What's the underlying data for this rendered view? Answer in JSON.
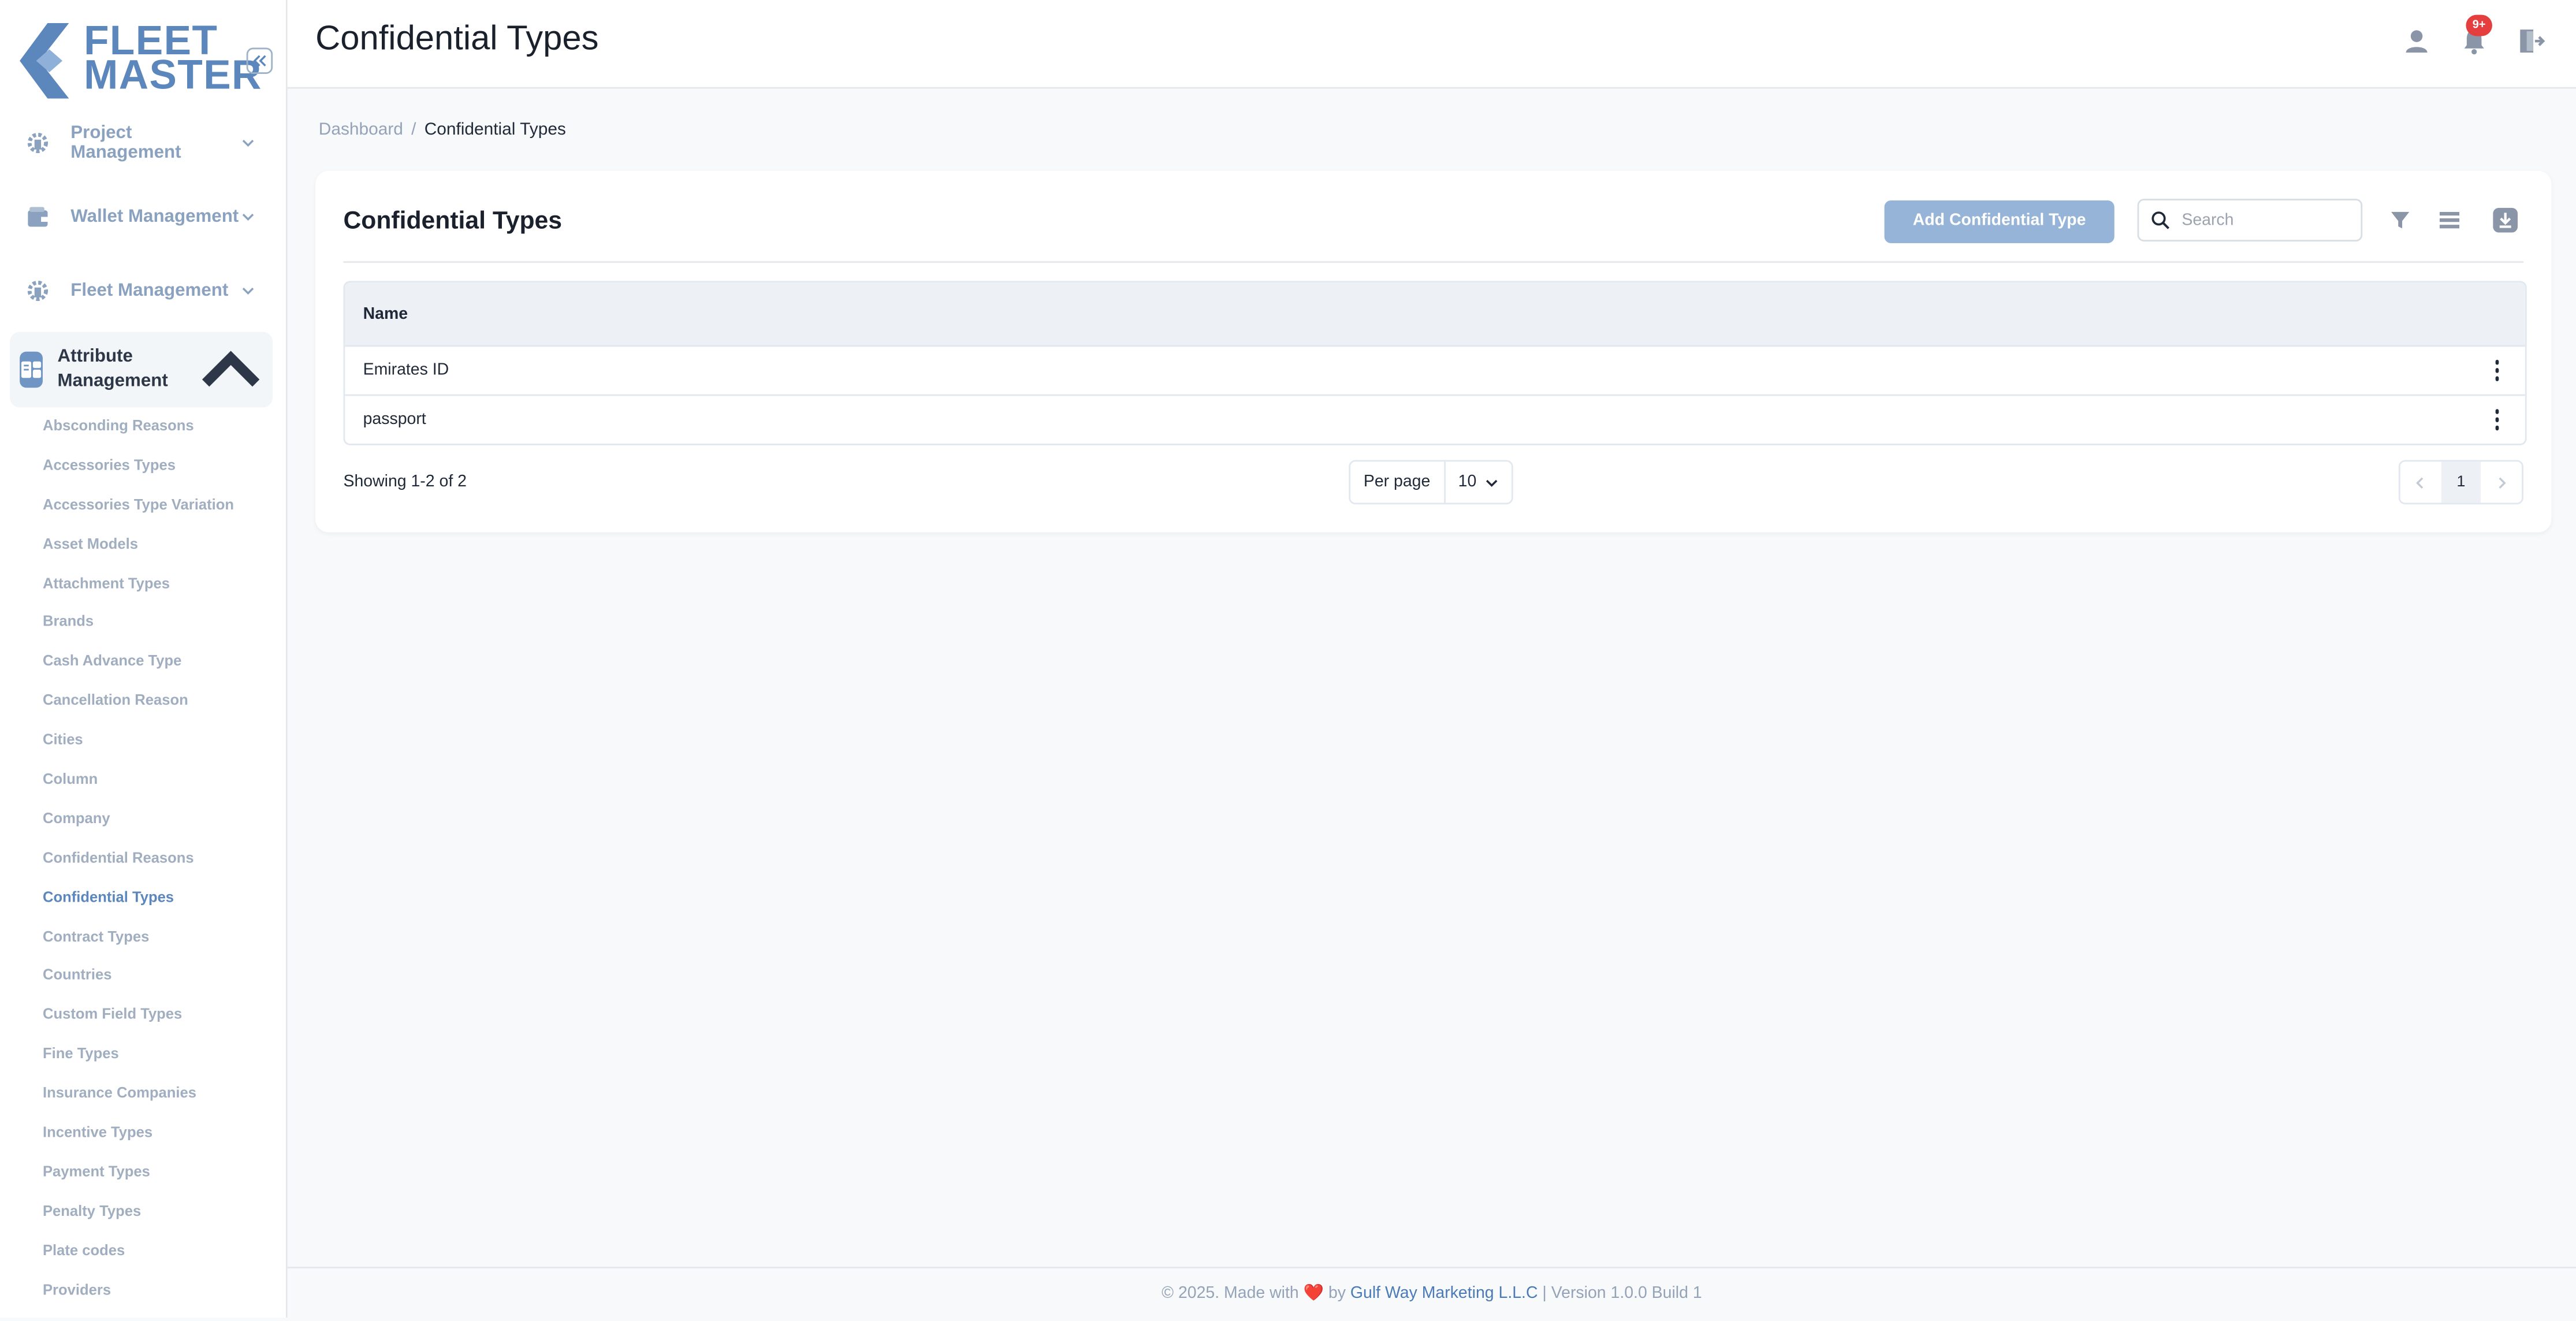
{
  "logo": {
    "line1": "FLEET",
    "line2": "MASTER"
  },
  "sidebar": {
    "groups": [
      {
        "label": "Project Management",
        "icon": "building-gear-icon"
      },
      {
        "label": "Wallet Management",
        "icon": "wallet-icon"
      },
      {
        "label": "Fleet Management",
        "icon": "building-gear-icon"
      }
    ],
    "active_group": {
      "label": "Attribute Management",
      "icon": "attribute-grid-icon"
    },
    "sub_items": [
      "Absconding Reasons",
      "Accessories Types",
      "Accessories Type Variation",
      "Asset Models",
      "Attachment Types",
      "Brands",
      "Cash Advance Type",
      "Cancellation Reason",
      "Cities",
      "Column",
      "Company",
      "Confidential Reasons",
      "Confidential Types",
      "Contract Types",
      "Countries",
      "Custom Field Types",
      "Fine Types",
      "Insurance Companies",
      "Incentive Types",
      "Payment Types",
      "Penalty Types",
      "Plate codes",
      "Providers"
    ],
    "active_sub_item": "Confidential Types"
  },
  "header": {
    "title": "Confidential Types",
    "notification_badge": "9+"
  },
  "breadcrumb": {
    "home": "Dashboard",
    "separator": "/",
    "current": "Confidential Types"
  },
  "card": {
    "title": "Confidential Types",
    "add_button": "Add Confidential Type",
    "search_placeholder": "Search"
  },
  "table": {
    "header": "Name",
    "rows": [
      "Emirates ID",
      "passport"
    ]
  },
  "pagination": {
    "showing": "Showing 1-2 of 2",
    "per_page_label": "Per page",
    "per_page_value": "10",
    "current_page": "1"
  },
  "footer": {
    "prefix": "© 2025. Made with",
    "by": "by",
    "company": "Gulf Way Marketing L.L.C",
    "version": "| Version 1.0.0 Build 1"
  },
  "colors": {
    "accent": "#5b87bd",
    "button": "#96b4d8",
    "badge": "#e53e3e"
  }
}
